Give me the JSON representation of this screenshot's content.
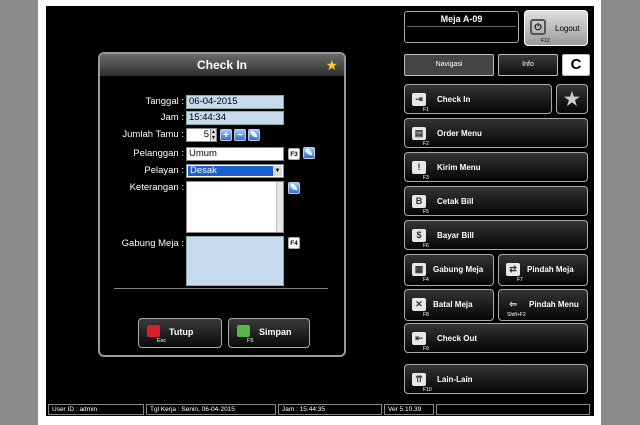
{
  "table": {
    "name": "Meja A-09"
  },
  "logout": {
    "label": "Logout",
    "key": "F12"
  },
  "tabs": {
    "navigasi": "Navigasi",
    "info": "Info",
    "clear": "C"
  },
  "nav": [
    {
      "label": "Check In",
      "key": "F1",
      "icon": "check-in-icon"
    },
    {
      "label": "Order Menu",
      "key": "F2",
      "icon": "order-icon"
    },
    {
      "label": "Kirim Menu",
      "key": "F3",
      "icon": "send-icon"
    },
    {
      "label": "Cetak Bill",
      "key": "F5",
      "icon": "print-bill-icon"
    },
    {
      "label": "Bayar Bill",
      "key": "F6",
      "icon": "pay-bill-icon"
    },
    {
      "label": "Gabung Meja",
      "key": "F4",
      "icon": "merge-table-icon"
    },
    {
      "label": "Pindah Meja",
      "key": "F7",
      "icon": "move-table-icon"
    },
    {
      "label": "Batal Meja",
      "key": "F8",
      "icon": "cancel-table-icon"
    },
    {
      "label": "Pindah Menu",
      "key": "Shift+F2",
      "icon": "move-menu-icon"
    },
    {
      "label": "Check Out",
      "key": "F9",
      "icon": "check-out-icon"
    },
    {
      "label": "Lain-Lain",
      "key": "F10",
      "icon": "other-icon"
    }
  ],
  "dialog": {
    "title": "Check In",
    "tanggal_label": "Tanggal :",
    "tanggal": "06-04-2015",
    "jam_label": "Jam :",
    "jam": "15:44:34",
    "jumlah_label": "Jumlah Tamu :",
    "jumlah": "5",
    "pelanggan_label": "Pelanggan :",
    "pelanggan": "Umum",
    "pelanggan_key": "F3",
    "pelayan_label": "Pelayan :",
    "pelayan": "Desak",
    "keterangan_label": "Keterangan :",
    "keterangan": "",
    "gabung_label": "Gabung Meja :",
    "gabung_key": "F4",
    "tutup": "Tutup",
    "tutup_key": "Esc",
    "simpan": "Simpan",
    "simpan_key": "F5"
  },
  "status": {
    "user": "User ID : admin",
    "tgl": "Tgl Kerja : Senin, 06-04-2015",
    "jam": "Jam : 15:44:35",
    "ver": "Ver 5.10.39"
  },
  "colors": {
    "star": "#ffd21e",
    "field": "#c6dbee",
    "select": "#1a5fd0"
  }
}
